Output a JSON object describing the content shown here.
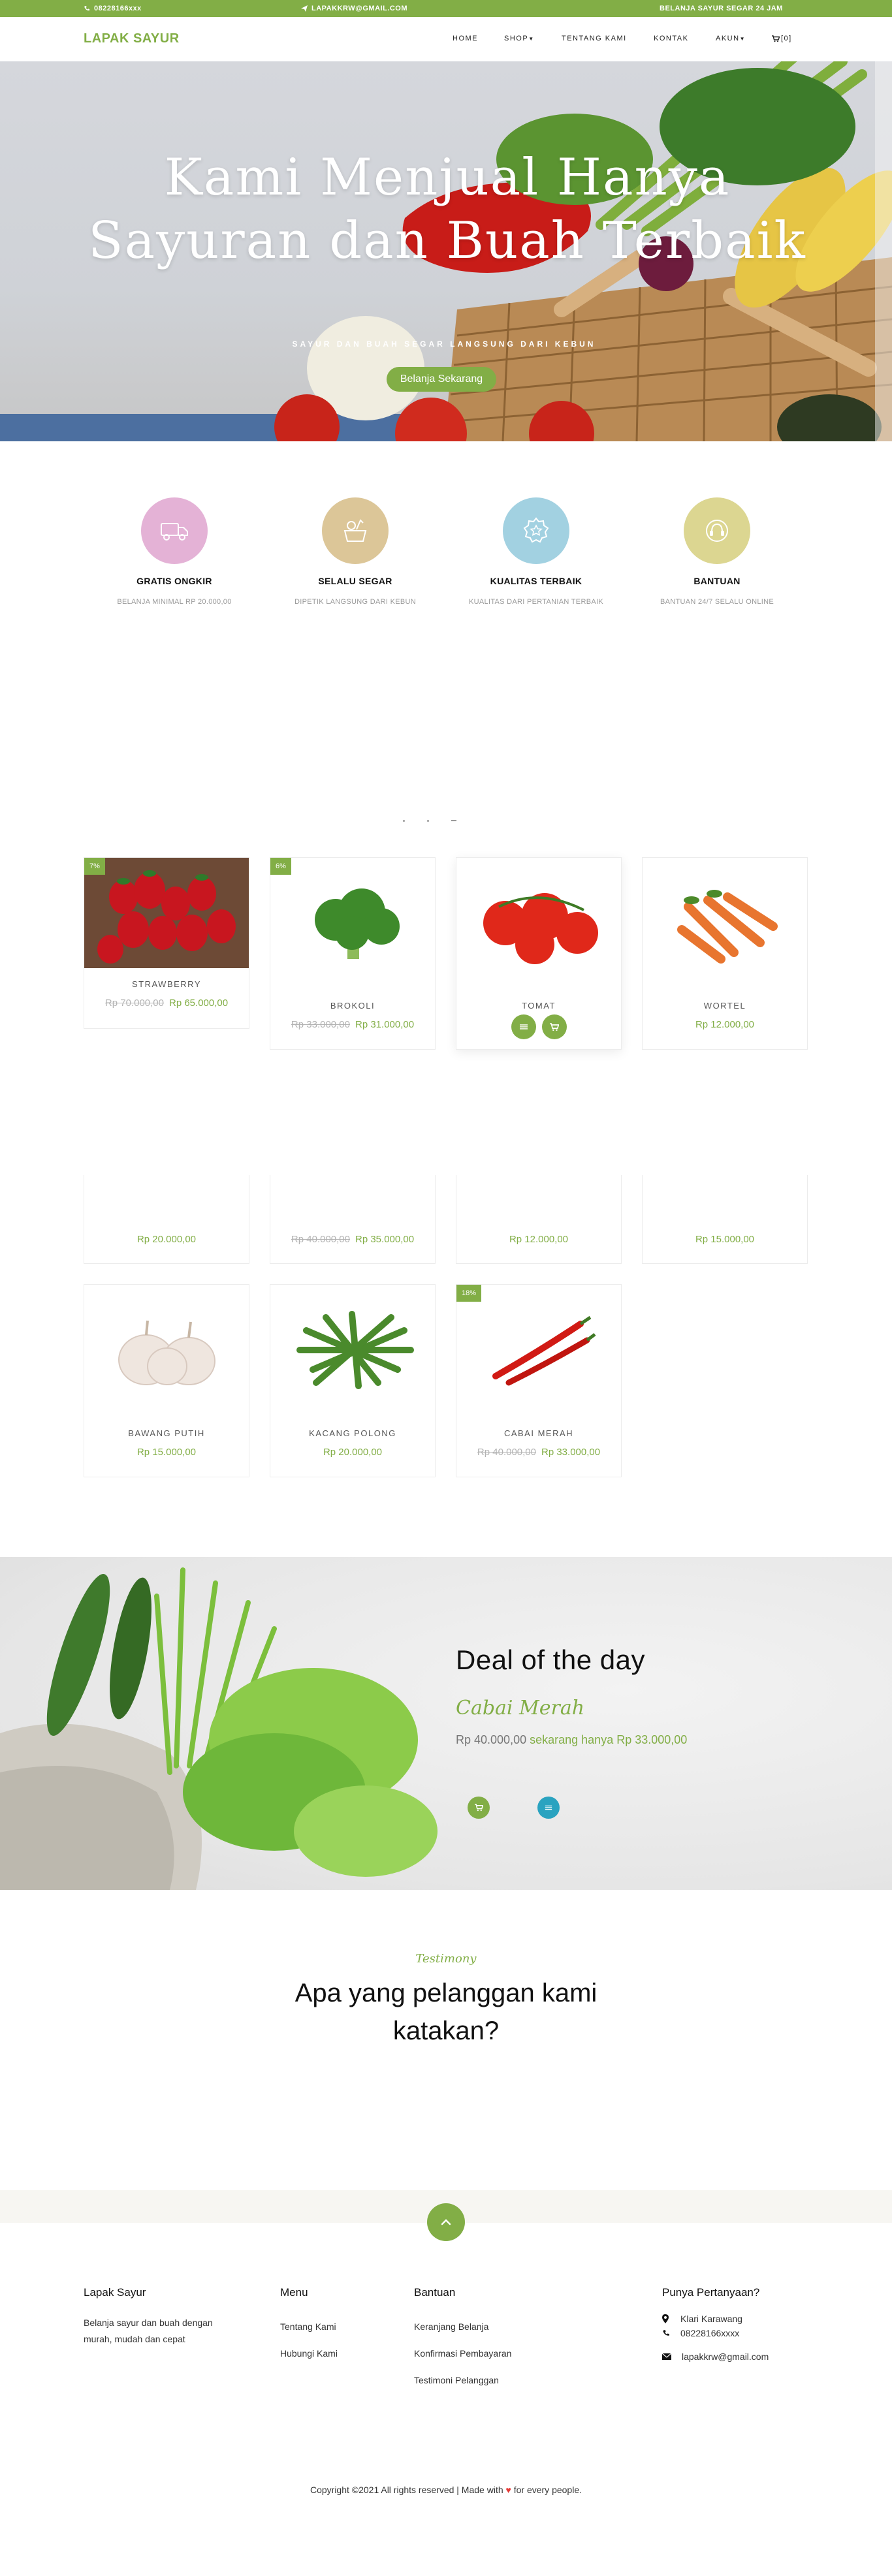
{
  "topbar": {
    "phone": "08228166xxx",
    "email": "LAPAKKRW@GMAIL.COM",
    "tagline": "BELANJA SAYUR SEGAR 24 JAM"
  },
  "nav": {
    "brand": "LAPAK SAYUR",
    "items": [
      {
        "label": "HOME"
      },
      {
        "label": "SHOP"
      },
      {
        "label": "TENTANG KAMI"
      },
      {
        "label": "KONTAK"
      },
      {
        "label": "AKUN"
      }
    ],
    "cart_count": "[0]"
  },
  "hero": {
    "title": "Kami Menjual Hanya Sayuran dan Buah Terbaik",
    "subtitle": "SAYUR DAN BUAH SEGAR LANGSUNG DARI KEBUN",
    "cta": "Belanja Sekarang"
  },
  "services": [
    {
      "title": "GRATIS ONGKIR",
      "desc": "BELANJA MINIMAL RP 20.000,00",
      "color": "#e4b2d6",
      "icon": "delivery-truck-icon"
    },
    {
      "title": "SELALU SEGAR",
      "desc": "DIPETIK LANGSUNG DARI KEBUN",
      "color": "#dcc698",
      "icon": "vegetable-basket-icon"
    },
    {
      "title": "KUALITAS TERBAIK",
      "desc": "KUALITAS DARI PERTANIAN TERBAIK",
      "color": "#a2d1e1",
      "icon": "quality-badge-icon"
    },
    {
      "title": "BANTUAN",
      "desc": "BANTUAN 24/7 SELALU ONLINE",
      "color": "#dcd691",
      "icon": "support-icon"
    }
  ],
  "products_row1": [
    {
      "name": "STRAWBERRY",
      "badge": "7%",
      "old_price": "Rp 70.000,00",
      "price": "Rp 65.000,00"
    },
    {
      "name": "BROKOLI",
      "badge": "6%",
      "old_price": "Rp 33.000,00",
      "price": "Rp 31.000,00"
    },
    {
      "name": "TOMAT",
      "badge": "",
      "old_price": "",
      "price": "Rp 12.000,00"
    },
    {
      "name": "WORTEL",
      "badge": "",
      "old_price": "",
      "price": "Rp 12.000,00"
    }
  ],
  "products_row2_prices": [
    {
      "old_price": "",
      "price": "Rp 20.000,00"
    },
    {
      "old_price": "Rp 40.000,00",
      "price": "Rp 35.000,00"
    },
    {
      "old_price": "",
      "price": "Rp 12.000,00"
    },
    {
      "old_price": "",
      "price": "Rp 15.000,00"
    }
  ],
  "products_row3": [
    {
      "name": "BAWANG PUTIH",
      "badge": "",
      "old_price": "",
      "price": "Rp 15.000,00"
    },
    {
      "name": "KACANG POLONG",
      "badge": "",
      "old_price": "",
      "price": "Rp 20.000,00"
    },
    {
      "name": "CABAI MERAH",
      "badge": "18%",
      "old_price": "Rp 40.000,00",
      "price": "Rp 33.000,00"
    }
  ],
  "deal": {
    "title": "Deal of the day",
    "product": "Cabai Merah",
    "old_price": "Rp 40.000,00",
    "offer": "sekarang hanya Rp 33.000,00"
  },
  "testimony": {
    "label": "Testimony",
    "title": "Apa yang pelanggan kami katakan?"
  },
  "footer": {
    "about_title": "Lapak Sayur",
    "about_desc": "Belanja sayur dan buah dengan murah, mudah dan cepat",
    "menu_title": "Menu",
    "menu_links": [
      "Tentang Kami",
      "Hubungi Kami"
    ],
    "help_title": "Bantuan",
    "help_links": [
      "Keranjang Belanja",
      "Konfirmasi Pembayaran",
      "Testimoni Pelanggan"
    ],
    "contact_title": "Punya Pertanyaan?",
    "address": "Klari Karawang",
    "phone": "08228166xxxx",
    "email": "lapakkrw@gmail.com",
    "copyright_pre": "Copyright ©2021 All rights reserved | Made with",
    "copyright_post": "for every people."
  },
  "colors": {
    "accent": "#82ae46",
    "heart": "#e53935"
  }
}
